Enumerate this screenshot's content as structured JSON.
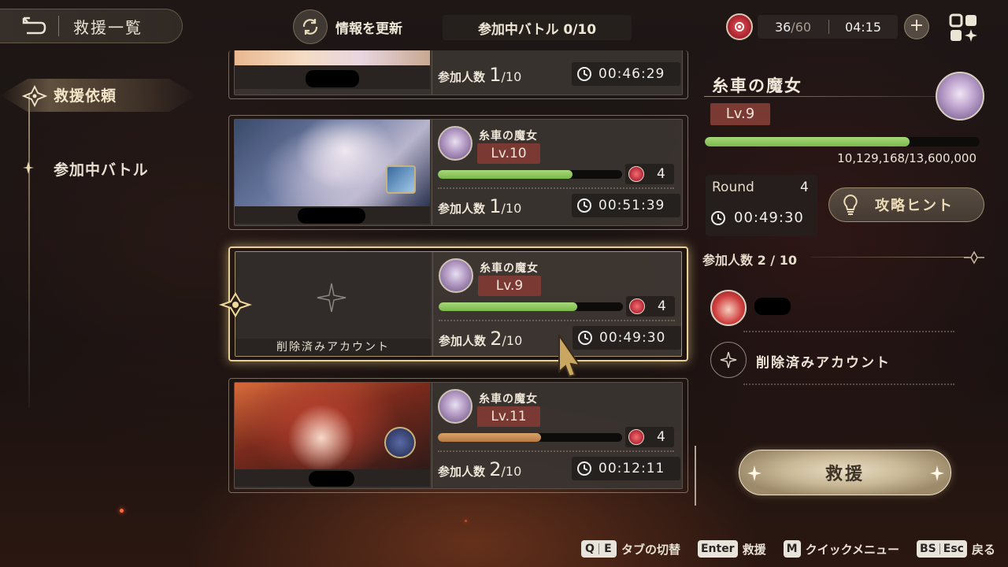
{
  "header": {
    "back_title": "救援一覧",
    "refresh_label": "情報を更新",
    "active_battles": "参加中バトル 0/10",
    "stamina_current": "36",
    "stamina_max": "/60",
    "stamina_timer": "04:15",
    "plus_label": "+"
  },
  "sidebar": {
    "items": [
      {
        "label": "救援依頼",
        "active": true
      },
      {
        "label": "参加中バトル",
        "active": false
      }
    ]
  },
  "battles": [
    {
      "boss_name": "",
      "level": "",
      "hp_percent": 0,
      "round": "",
      "participants_count": "1",
      "participants_max": "/10",
      "participants_label": "参加人数",
      "timer": "00:46:29",
      "owner": ""
    },
    {
      "boss_name": "糸車の魔女",
      "level": "Lv.10",
      "hp_percent": 73,
      "round": "4",
      "participants_count": "1",
      "participants_max": "/10",
      "participants_label": "参加人数",
      "timer": "00:51:39",
      "owner": ""
    },
    {
      "boss_name": "糸車の魔女",
      "level": "Lv.9",
      "hp_percent": 75,
      "round": "4",
      "participants_count": "2",
      "participants_max": "/10",
      "participants_label": "参加人数",
      "timer": "00:49:30",
      "owner": "削除済みアカウント"
    },
    {
      "boss_name": "糸車の魔女",
      "level": "Lv.11",
      "hp_percent": 56,
      "round": "4",
      "participants_count": "2",
      "participants_max": "/10",
      "participants_label": "参加人数",
      "timer": "00:12:11",
      "owner": ""
    }
  ],
  "detail": {
    "boss_name": "糸車の魔女",
    "level": "Lv.9",
    "hp_current_max": "10,129,168/13,600,000",
    "hp_percent": 74.5,
    "round_label": "Round",
    "round_value": "4",
    "timer": "00:49:30",
    "hint_label": "攻略ヒント",
    "participants_header": "参加人数 2 / 10",
    "participants": [
      {
        "name": ""
      },
      {
        "name": "削除済みアカウント"
      }
    ],
    "rescue_label": "救援"
  },
  "footer": {
    "items": [
      {
        "keys": [
          "Q",
          "E"
        ],
        "label": "タブの切替"
      },
      {
        "keys": [
          "Enter"
        ],
        "label": "救援"
      },
      {
        "keys": [
          "M"
        ],
        "label": "クイックメニュー"
      },
      {
        "keys": [
          "BS",
          "Esc"
        ],
        "label": "戻る"
      }
    ]
  },
  "colors": {
    "hp_green": "#8cc860",
    "hp_brown": "#c88d55",
    "level_badge": "#7a3a33",
    "accent_gold": "#e8cf95"
  }
}
